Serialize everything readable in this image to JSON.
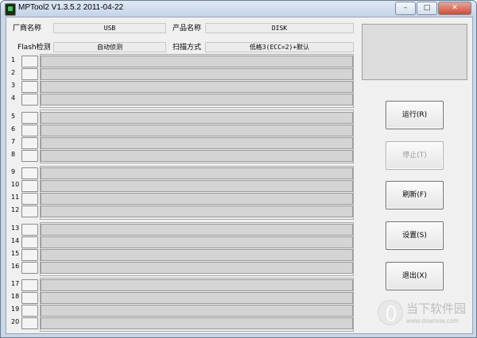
{
  "window": {
    "title": "MPTool2 V1.3.5.2 2011-04-22",
    "controls": [
      "minimize",
      "maximize",
      "close"
    ]
  },
  "info": {
    "vendor_label": "厂商名称",
    "vendor_value": "USB",
    "product_label": "产品名称",
    "product_value": "DISK",
    "flash_label": "Flash检测",
    "flash_value": "自动侦测",
    "scan_label": "扫描方式",
    "scan_value": "低格3(ECC=2)+默认"
  },
  "ports": [
    "1",
    "2",
    "3",
    "4",
    "5",
    "6",
    "7",
    "8",
    "9",
    "10",
    "11",
    "12",
    "13",
    "14",
    "15",
    "16",
    "17",
    "18",
    "19",
    "20"
  ],
  "buttons": {
    "run": "运行(R)",
    "stop": "停止(T)",
    "refresh": "刷新(F)",
    "settings": "设置(S)",
    "exit": "退出(X)"
  },
  "watermark": {
    "name": "当下软件园",
    "url": "www.downxia.com"
  }
}
